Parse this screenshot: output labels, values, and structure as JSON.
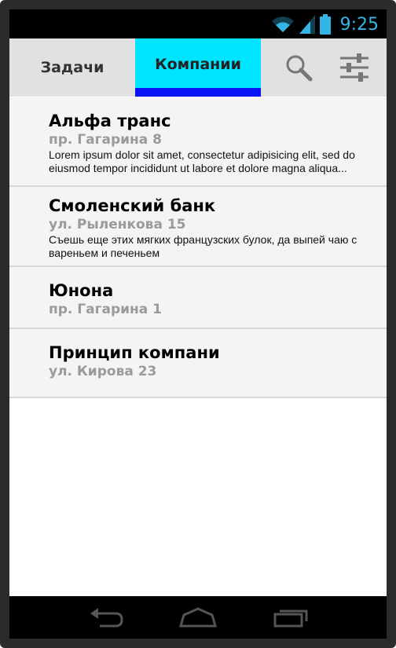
{
  "status_bar": {
    "time": "9:25",
    "icons": [
      "wifi-icon",
      "signal-icon",
      "battery-icon"
    ],
    "accent_color": "#33b5e5"
  },
  "tabs": [
    {
      "label": "Задачи",
      "selected": false
    },
    {
      "label": "Компании",
      "selected": true
    }
  ],
  "actions": [
    "search-icon",
    "settings-sliders-icon"
  ],
  "colors": {
    "selected_tab_bg": "#00e5ff",
    "selected_tab_indicator": "#0b13f5",
    "tab_bar_bg": "#e1e1e1",
    "address_text": "#9a9a9a"
  },
  "companies": [
    {
      "name": "Альфа транс",
      "address": "пр. Гагарина 8",
      "description": "Lorem ipsum dolor sit amet, consectetur adipisicing elit, sed do eiusmod tempor incididunt ut labore et dolore magna aliqua..."
    },
    {
      "name": "Смоленский банк",
      "address": "ул. Рыленкова 15",
      "description": "Съешь еще этих мягких французских булок, да выпей чаю с вареньем и печеньем"
    },
    {
      "name": "Юнона",
      "address": "пр. Гагарина 1",
      "description": ""
    },
    {
      "name": "Принцип компани",
      "address": "ул. Кирова 23",
      "description": ""
    }
  ],
  "nav_bar": [
    "back-icon",
    "home-icon",
    "recent-apps-icon"
  ]
}
